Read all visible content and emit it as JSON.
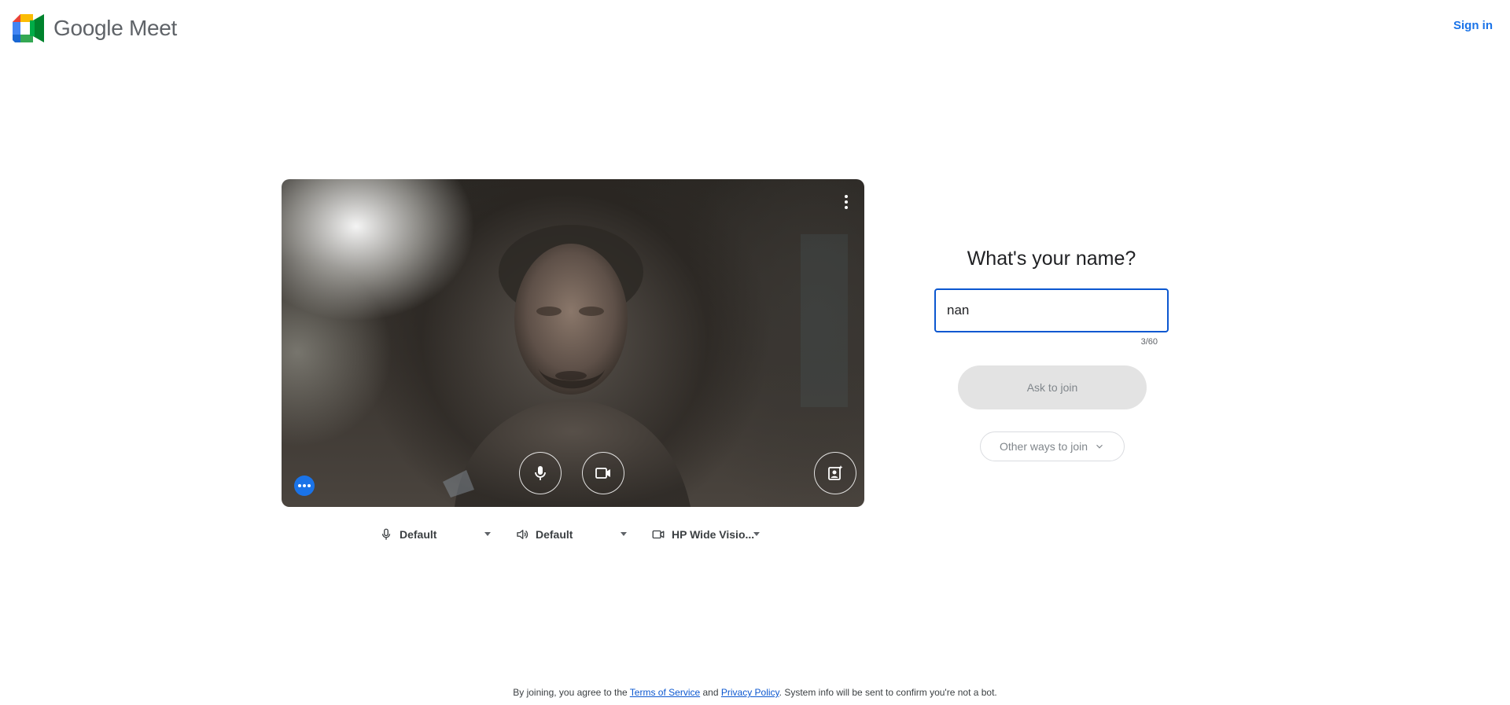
{
  "header": {
    "brand_name": "Google Meet",
    "sign_in_label": "Sign in"
  },
  "preview": {
    "more_options_icon": "more-vert-icon",
    "effects_icon": "more-horiz-icon",
    "mic_icon": "mic-icon",
    "camera_icon": "videocam-icon",
    "background_icon": "person-add-background-icon"
  },
  "devices": {
    "microphone": {
      "icon": "mic-outline-icon",
      "label": "Default"
    },
    "speaker": {
      "icon": "speaker-icon",
      "label": "Default"
    },
    "camera": {
      "icon": "videocam-outline-icon",
      "label": "HP Wide Visio..."
    }
  },
  "join": {
    "title": "What's your name?",
    "name_value": "nan",
    "char_count": "3/60",
    "ask_label": "Ask to join",
    "other_ways_label": "Other ways to join"
  },
  "footer": {
    "prefix": "By joining, you agree to the",
    "terms_label": "Terms of Service",
    "and_text": "and",
    "privacy_label": "Privacy Policy",
    "suffix": ". System info will be sent to confirm you're not a bot."
  },
  "colors": {
    "accent": "#1a73e8",
    "focus_border": "#0b57d0",
    "disabled_button": "#e3e3e3"
  }
}
